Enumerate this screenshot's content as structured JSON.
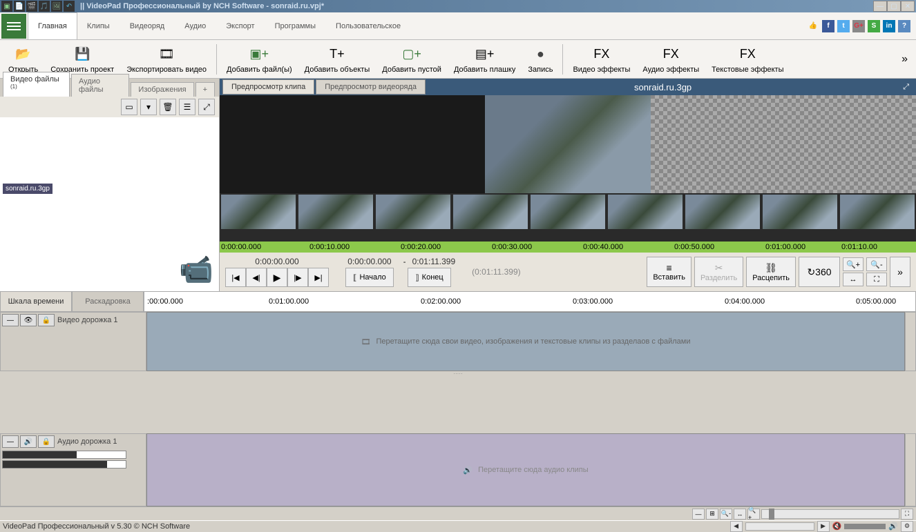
{
  "titlebar": {
    "title": "|| VideoPad Профессиональный by NCH Software - sonraid.ru.vpj*"
  },
  "menu": {
    "tabs": [
      "Главная",
      "Клипы",
      "Видеоряд",
      "Аудио",
      "Экспорт",
      "Программы",
      "Пользовательское"
    ]
  },
  "toolbar": {
    "open": "Открыть",
    "save": "Сохранить проект",
    "export": "Экспортировать видео",
    "add_files": "Добавить файл(ы)",
    "add_objects": "Добавить объекты",
    "add_empty": "Добавить пустой",
    "add_plate": "Добавить плашку",
    "record": "Запись",
    "video_fx": "Видео эффекты",
    "audio_fx": "Аудио эффекты",
    "text_fx": "Текстовые эффекты"
  },
  "file_tabs": {
    "video": "Видео файлы",
    "video_count": "(1)",
    "audio": "Аудио файлы",
    "images": "Изображения",
    "plus": "+"
  },
  "file_item": "sonraid.ru.3gp",
  "preview": {
    "tab_clip": "Предпросмотр клипа",
    "tab_sequence": "Предпросмотр видеоряда",
    "title": "sonraid.ru.3gp"
  },
  "filmstrip_times": [
    "0:00:00.000",
    "0:00:10.000",
    "0:00:20.000",
    "0:00:30.000",
    "0:00:40.000",
    "0:00:50.000",
    "0:01:00.000",
    "0:01:10.00"
  ],
  "playback": {
    "time1": "0:00:00.000",
    "time2": "0:00:00.000",
    "dash": "-",
    "time3": "0:01:11.399",
    "time4": "(0:01:11.399)",
    "start": "Начало",
    "end": "Конец",
    "insert": "Вставить",
    "split": "Разделить",
    "unlink": "Расцепить"
  },
  "timeline": {
    "tab_scale": "Шкала времени",
    "tab_storyboard": "Раскадровка",
    "ruler": [
      ":00:00.000",
      "0:01:00.000",
      "0:02:00.000",
      "0:03:00.000",
      "0:04:00.000",
      "0:05:00.000"
    ],
    "video_track": "Видео дорожка 1",
    "video_hint": "Перетащите сюда свои видео, изображения и текстовые клипы из разделаов с файлами",
    "audio_track": "Аудио дорожка 1",
    "audio_hint": "Перетащите сюда аудио клипы"
  },
  "statusbar": {
    "text": "VideoPad Профессиональный v 5.30 © NCH Software"
  }
}
